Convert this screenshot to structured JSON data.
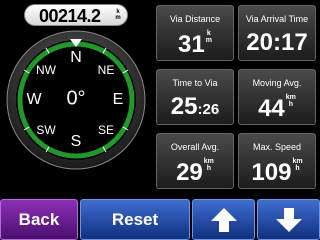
{
  "odometer": {
    "value": "00214.2",
    "unit": "km"
  },
  "compass": {
    "heading": "0°",
    "labels": {
      "n": "N",
      "ne": "NE",
      "e": "E",
      "se": "SE",
      "s": "S",
      "sw": "SW",
      "w": "W",
      "nw": "NW"
    },
    "ring_color": "#1f9a2a"
  },
  "tiles": [
    {
      "label": "Via Distance",
      "value": "31",
      "unit": "km"
    },
    {
      "label": "Via Arrival Time",
      "value": "20:17",
      "unit": ""
    },
    {
      "label": "Time to Via",
      "value": "25",
      "value_small": ":26",
      "unit": ""
    },
    {
      "label": "Moving Avg.",
      "value": "44",
      "unit": "kmh"
    },
    {
      "label": "Overall Avg.",
      "value": "29",
      "unit": "kmh"
    },
    {
      "label": "Max. Speed",
      "value": "109",
      "unit": "kmh"
    }
  ],
  "buttons": {
    "back": "Back",
    "reset": "Reset",
    "up_icon": "arrow-up-icon",
    "down_icon": "arrow-down-icon"
  }
}
